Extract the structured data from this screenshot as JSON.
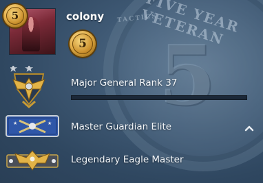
{
  "profile": {
    "username": "colony",
    "level": "5",
    "avatar_icon": "avatar-photo"
  },
  "background_text": {
    "banner": "FIVE YEAR VETERAN",
    "sub": "TACTICS"
  },
  "ranks": [
    {
      "label": "Major General Rank 37",
      "icon": "major-general-eagle-icon",
      "progress": 0
    },
    {
      "label": "Master Guardian Elite",
      "icon": "master-guardian-elite-icon",
      "expanded": true
    },
    {
      "label": "Legendary Eagle Master",
      "icon": "legendary-eagle-master-icon"
    }
  ],
  "colors": {
    "background": "#3e5873",
    "gold": "#e3b04c",
    "progress_track": "#1b2838",
    "text": "#f1f4f7"
  }
}
